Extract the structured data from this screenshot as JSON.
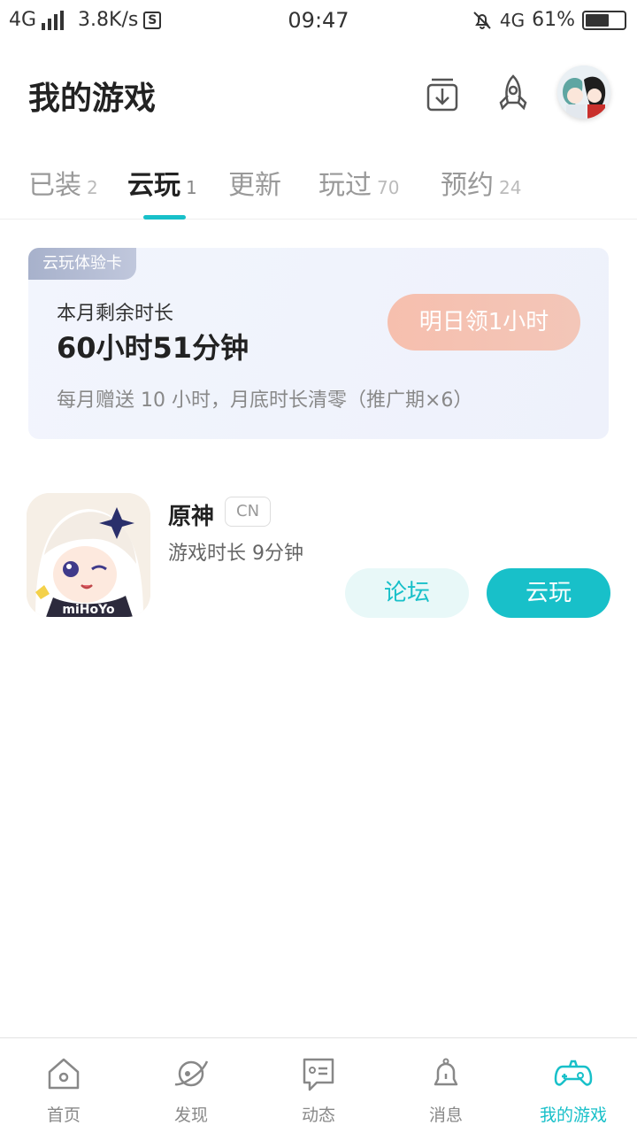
{
  "status_bar": {
    "network": "4G",
    "speed": "3.8K/s",
    "s_badge": "S",
    "time": "09:47",
    "network2": "4G",
    "battery_percent": "61%",
    "battery_level": 0.61
  },
  "header": {
    "title": "我的游戏",
    "icons": [
      "download-icon",
      "rocket-icon",
      "avatar"
    ]
  },
  "tabs": [
    {
      "label": "已装",
      "count": "2"
    },
    {
      "label": "云玩",
      "count": "1",
      "active": true
    },
    {
      "label": "更新",
      "count": ""
    },
    {
      "label": "玩过",
      "count": "70"
    },
    {
      "label": "预约",
      "count": "24"
    }
  ],
  "cloud_card": {
    "badge": "云玩体验卡",
    "subtitle": "本月剩余时长",
    "remaining": "60小时51分钟",
    "claim_button": "明日领1小时",
    "note": "每月赠送 10 小时，月底时长清零（推广期×6）"
  },
  "game": {
    "name": "原神",
    "region": "CN",
    "playtime": "游戏时长 9分钟",
    "icon_brand": "miHoYo",
    "forum_button": "论坛",
    "play_button": "云玩"
  },
  "bottom_nav": [
    {
      "label": "首页",
      "icon": "home-icon"
    },
    {
      "label": "发现",
      "icon": "planet-icon"
    },
    {
      "label": "动态",
      "icon": "chat-icon"
    },
    {
      "label": "消息",
      "icon": "bell-icon"
    },
    {
      "label": "我的游戏",
      "icon": "gamepad-icon",
      "active": true
    }
  ],
  "colors": {
    "accent": "#18c0c9",
    "claim_button": "#f4c1b1",
    "card_bg": "#f0f3fc"
  }
}
